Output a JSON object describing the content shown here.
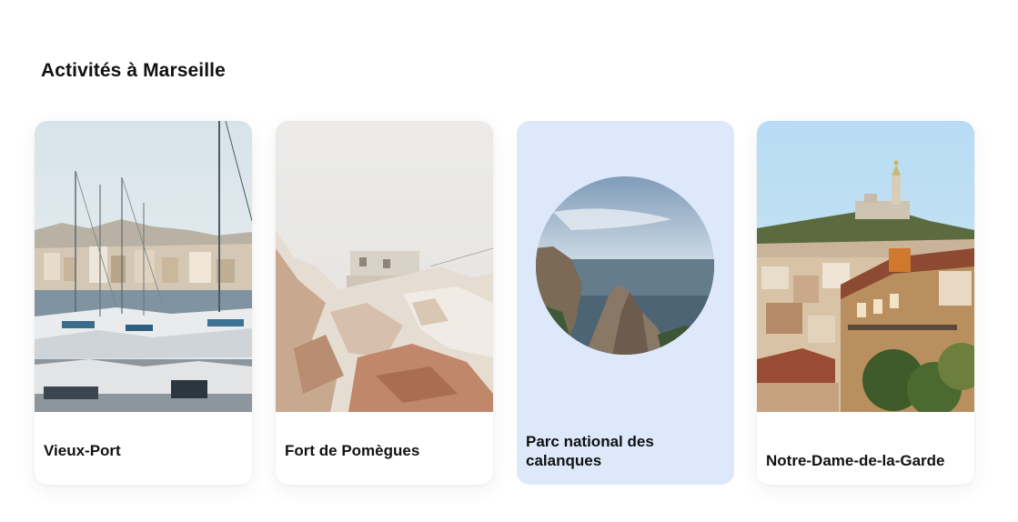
{
  "section": {
    "title": "Activités à Marseille"
  },
  "cards": [
    {
      "label": "Vieux-Port",
      "image": "harbor-sailboats-image"
    },
    {
      "label": "Fort de Pomègues",
      "image": "fort-on-rocks-image"
    },
    {
      "label": "Parc national des calanques",
      "image": "calanques-cliffs-image"
    },
    {
      "label": "Notre-Dame-de-la-Garde",
      "image": "basilica-hilltop-image"
    }
  ],
  "colors": {
    "highlight_card": "#dde9fb",
    "card_bg": "#ffffff",
    "text": "#111111"
  }
}
